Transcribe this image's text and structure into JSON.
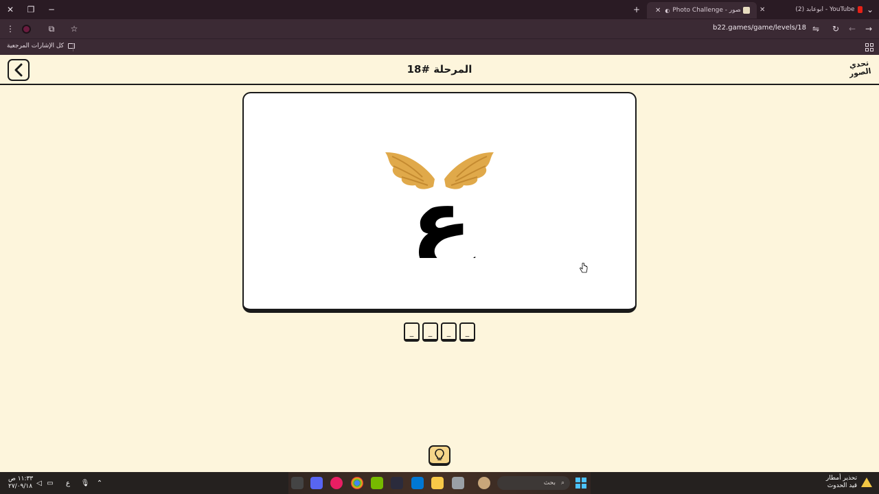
{
  "browser": {
    "tabs": [
      {
        "title": "(2) ابوعابد - YouTube",
        "active": false
      },
      {
        "title": "Photo Challenge - تحدي الصور",
        "active": true
      }
    ],
    "url": "b22.games/game/levels/18",
    "bookmarks_folder": "كل الإشارات المرجعية"
  },
  "game": {
    "level_title": "المرحلة #18",
    "logo_line1": "تحدي",
    "logo_line2": "الصور",
    "answer_slots": [
      "_",
      "_",
      "_",
      "_"
    ],
    "picture_glyph": "ع",
    "picture_wing_color": "#e0a94a"
  },
  "taskbar": {
    "time": "١١:٣٣ ص",
    "date": "٢٧/٠٩/١٨",
    "input_lang": "ع",
    "search_placeholder": "بحث",
    "weather_line1": "تحذير أمطار",
    "weather_line2": "قيد الحدوث"
  }
}
